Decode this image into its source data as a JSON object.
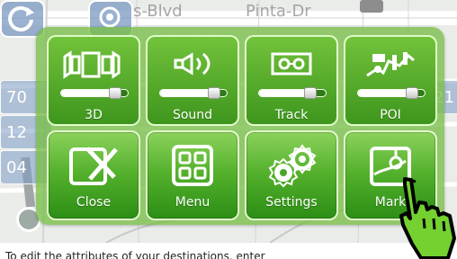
{
  "map": {
    "streets": [
      "s-Blvd",
      "Pinta-Dr"
    ],
    "left_numbers": [
      "70",
      "12",
      "04"
    ],
    "right_number": "21"
  },
  "panel": {
    "controls": [
      {
        "label": "3D",
        "icon": "3d-view-icon",
        "level_percent": 90
      },
      {
        "label": "Sound",
        "icon": "speaker-sound-icon",
        "level_percent": 90
      },
      {
        "label": "Track",
        "icon": "track-recorder-icon",
        "level_percent": 86
      },
      {
        "label": "POI",
        "icon": "poi-icon",
        "level_percent": 90
      }
    ],
    "buttons": [
      {
        "label": "Close",
        "icon": "close-icon"
      },
      {
        "label": "Menu",
        "icon": "menu-grid-icon"
      },
      {
        "label": "Settings",
        "icon": "settings-gears-icon"
      },
      {
        "label": "Mark",
        "icon": "map-pin-icon"
      }
    ]
  },
  "caption": "To edit the attributes of your destinations, enter",
  "colors": {
    "panel": "#79be48",
    "tile": "#56ae2b",
    "slider_track": "#2d7a16",
    "map_bg": "#e9ece8",
    "hand": "#74d12f"
  }
}
